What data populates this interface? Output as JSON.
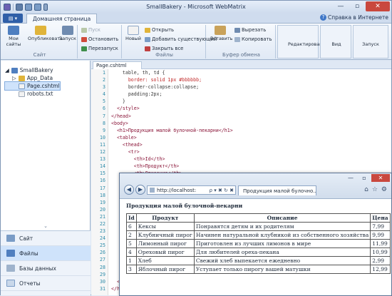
{
  "window": {
    "title": "SmallBakery - Microsoft WebMatrix"
  },
  "ribbon": {
    "app_tab": "▤ ▾",
    "home_tab": "Домашняя страница",
    "help_label": "Справка в Интернете",
    "groups": {
      "site": {
        "label": "Сайт",
        "my_sites": "Мои сайты",
        "publish": "Опубликовать",
        "run": "Запуск"
      },
      "site_small": {
        "start": "Пуск",
        "stop": "Остановить",
        "restart": "Перезапуск"
      },
      "files": {
        "label": "Файлы",
        "new": "Новый",
        "open": "Открыть",
        "add_existing": "Добавить существующий",
        "close_all": "Закрыть все"
      },
      "clipboard": {
        "label": "Буфер обмена",
        "paste": "Вставить",
        "cut": "Вырезать",
        "copy": "Копировать"
      },
      "edit": {
        "label": "Редактирование"
      },
      "view": {
        "label": "Вид"
      },
      "run": {
        "label": "Запуск"
      }
    }
  },
  "nav": {
    "tree": [
      {
        "label": "SmallBakery"
      },
      {
        "label": "App_Data"
      },
      {
        "label": "Page.cshtml"
      },
      {
        "label": "robots.txt"
      }
    ],
    "workspaces": [
      {
        "label": "Сайт"
      },
      {
        "label": "Файлы"
      },
      {
        "label": "Базы данных"
      },
      {
        "label": "Отчеты"
      }
    ]
  },
  "editor": {
    "tab": "Page.cshtml",
    "line_numbers": [
      "1",
      "2",
      "3",
      "4",
      "5",
      "6",
      "7",
      "8",
      "9",
      "10",
      "11",
      "12",
      "13",
      "14",
      "15",
      "16",
      "17",
      "18",
      "19",
      "20",
      "21",
      "22",
      "23",
      "24",
      "25",
      "26",
      "27",
      "28",
      "29",
      "30",
      "31"
    ],
    "lines": [
      "    table, th, td {",
      "      border: solid 1px #bbbbbb;",
      "      border-collapse:collapse;",
      "      padding:2px;",
      "    }",
      "  </style>",
      "</head>",
      "<body>",
      "  <h1>Продукция малой булочной-пекарни</h1>",
      "  <table>",
      "    <thead>",
      "      <tr>",
      "        <th>Id</th>",
      "        <th>Продукт</th>",
      "        <th>Описание</th>",
      "",
      "",
      "",
      "",
      "",
      "",
      "",
      "",
      "",
      "",
      "",
      "",
      "",
      "",
      "  </",
      "</html>"
    ]
  },
  "browser": {
    "address": "http://localhost:",
    "address_icons": "ρ ▾ ✖ ↻ ✖",
    "tab_title": "Продукция малой булочно...",
    "controls": [
      "—",
      "▫",
      "✕"
    ],
    "toolbar_icons": [
      "⌂",
      "☆",
      "⚙"
    ],
    "heading": "Продукция малой булочной-пекарни",
    "columns": [
      "Id",
      "Продукт",
      "Описание",
      "Цена"
    ],
    "rows": [
      [
        "6",
        "Кексы",
        "Понравятся детям и их родителям",
        "7,99"
      ],
      [
        "2",
        "Клубничный пирог",
        "Начинен натуральной клубникой из собственного хозяйства",
        "9,99"
      ],
      [
        "5",
        "Лимонный пирог",
        "Приготовлен из лучших лимонов в мире",
        "11,99"
      ],
      [
        "4",
        "Ореховый пирог",
        "Для любителей ореха-пекана",
        "10,99"
      ],
      [
        "1",
        "Хлеб",
        "Свежий хлеб выпекается ежедневно",
        "2,99"
      ],
      [
        "3",
        "Яблочный пирог",
        "Уступает только пирогу вашей матушки",
        "12,99"
      ]
    ]
  },
  "colors": {
    "accent": "#2f5fa8",
    "close_red": "#c9483e",
    "selection": "#cfe3fb"
  }
}
